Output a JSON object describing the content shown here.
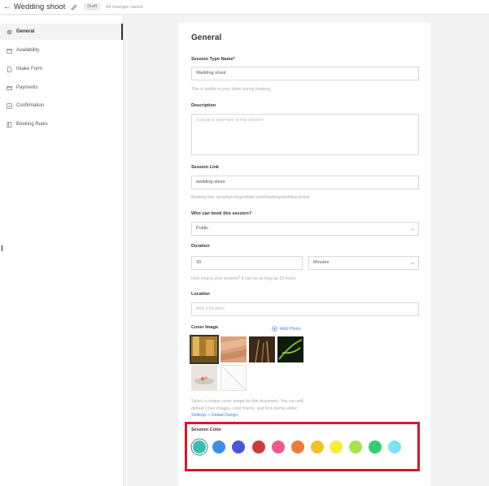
{
  "topbar": {
    "title": "Wedding shoot",
    "badge": "Draft",
    "status": "All changes saved"
  },
  "sidebar": {
    "items": [
      {
        "label": "General",
        "icon": "gear-icon",
        "active": true
      },
      {
        "label": "Availability",
        "icon": "calendar-icon",
        "active": false
      },
      {
        "label": "Intake Form",
        "icon": "document-icon",
        "active": false
      },
      {
        "label": "Payments",
        "icon": "card-icon",
        "active": false
      },
      {
        "label": "Confirmation",
        "icon": "checkbox-icon",
        "active": false
      },
      {
        "label": "Booking Rules",
        "icon": "book-icon",
        "active": false
      }
    ]
  },
  "form": {
    "heading": "General",
    "session_type_name": {
      "label": "Session Type Name*",
      "value": "Wedding shoot",
      "helper": "This is visible to your client during booking."
    },
    "description": {
      "label": "Description",
      "placeholder": "Include a summary of this session"
    },
    "session_link": {
      "label": "Session Link",
      "value": "wedding-shoot",
      "helper": "Booking link: /prophan.myportfolio.com/booking/wedding-shoot/"
    },
    "who_can_book": {
      "label": "Who can book this session?",
      "value": "Public"
    },
    "duration": {
      "label": "Duration",
      "value": "30",
      "unit": "Minutes",
      "helper": "How long is your session? It can be as long as 16 hours."
    },
    "location": {
      "label": "Location",
      "placeholder": "Add a location"
    },
    "cover_image": {
      "label": "Cover Image",
      "add_photo": "Add Photo",
      "note_prefix": "Select a unique cover image for this document. You can edit default cover images, color theme, and font theme under",
      "note_link": "Settings > Global Design."
    },
    "session_color": {
      "label": "Session Color",
      "selected_index": 0,
      "colors": [
        "#3bbcb0",
        "#3d8fe0",
        "#4a55d9",
        "#cc3a3a",
        "#ee5a8f",
        "#ee7a3e",
        "#f2c02a",
        "#f6ec3a",
        "#a6e34a",
        "#36cc6a",
        "#7ae2f2"
      ]
    }
  }
}
